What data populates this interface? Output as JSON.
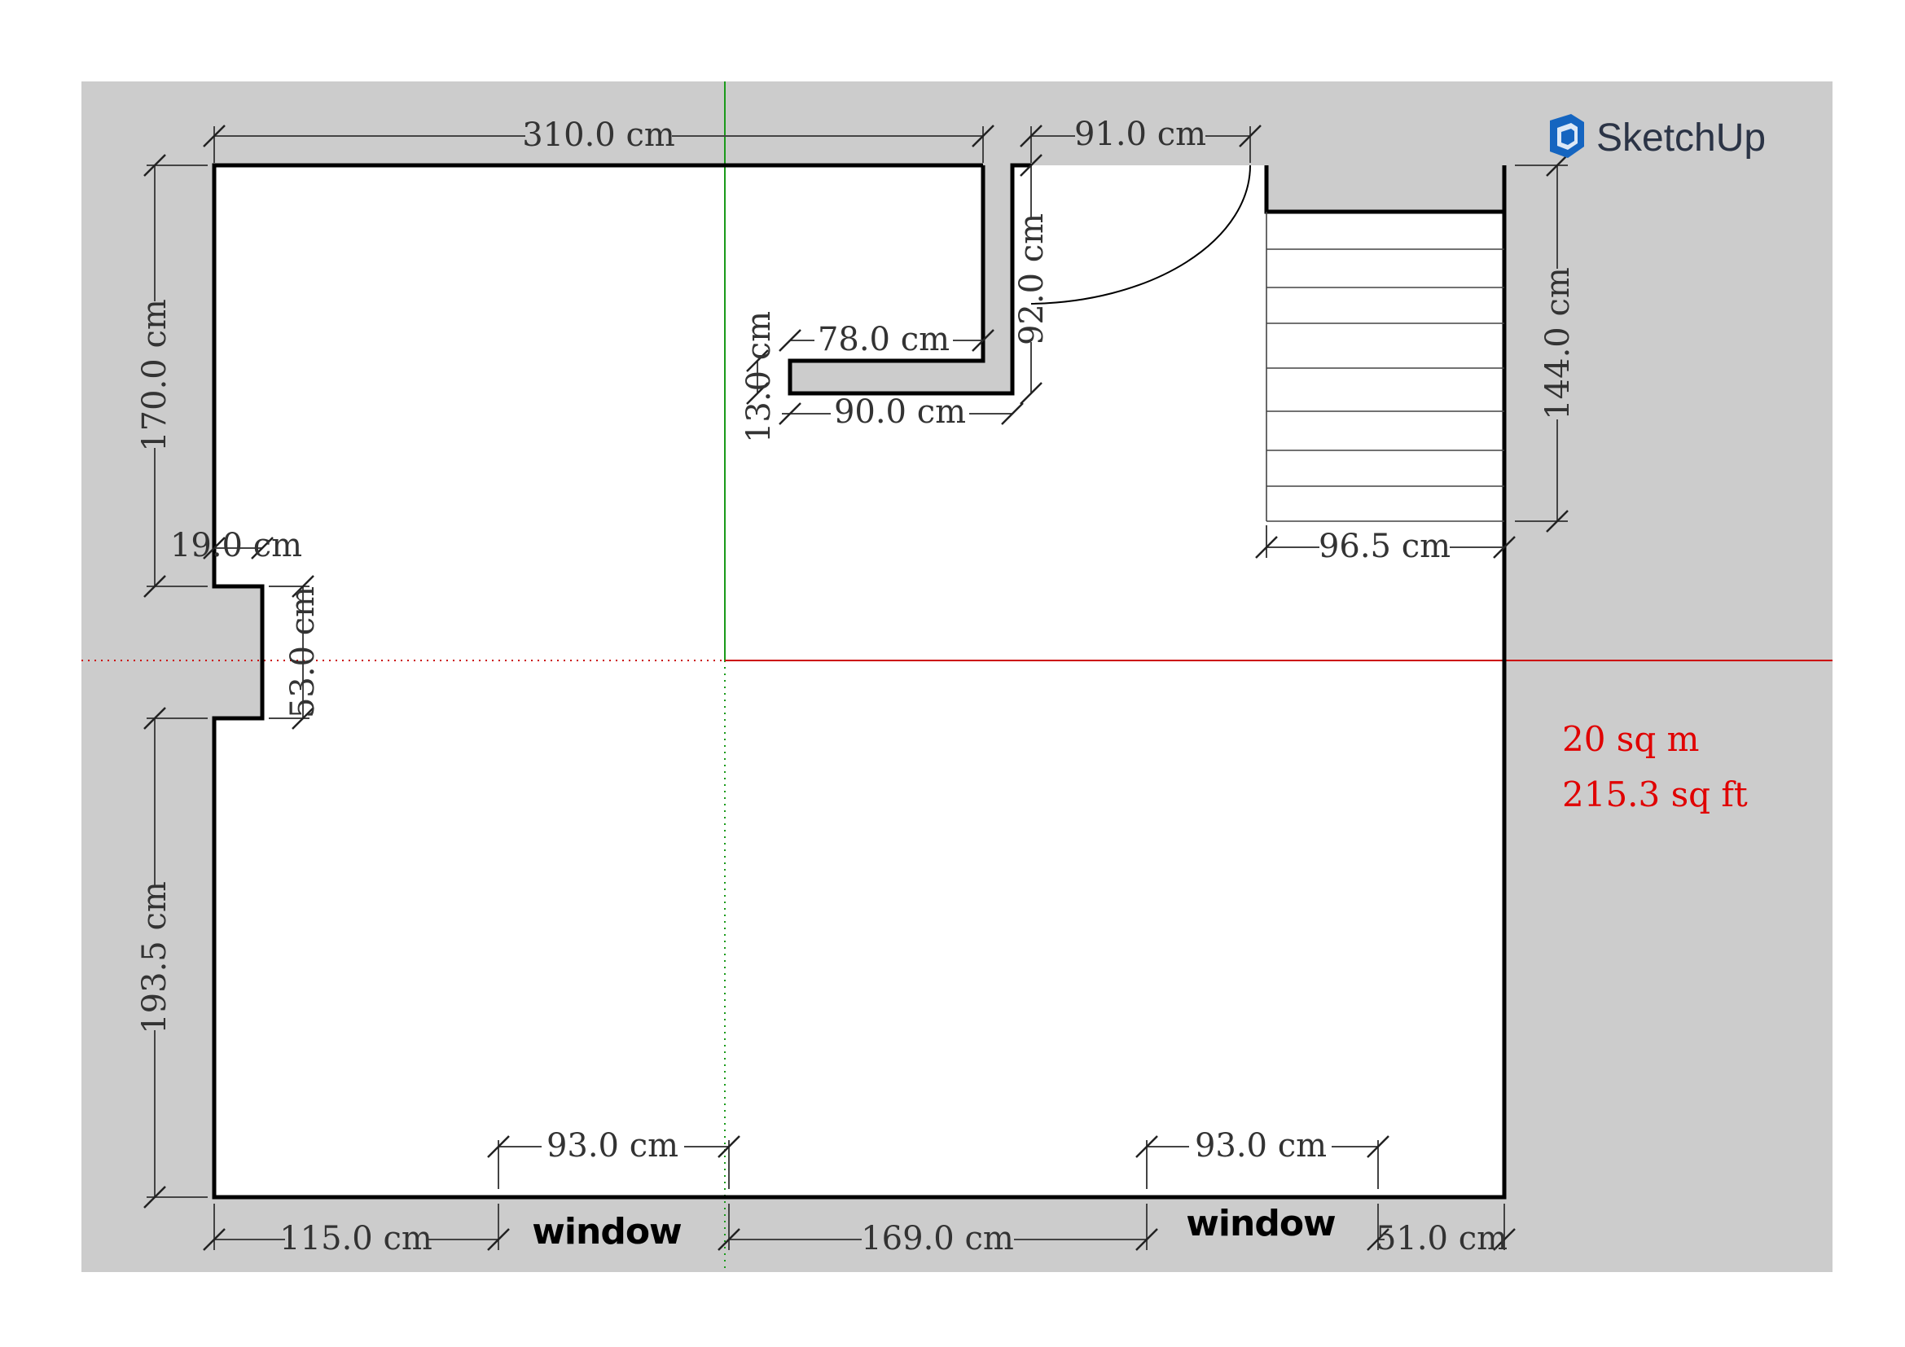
{
  "brand": {
    "name": "SketchUp",
    "logo_icon": "sketchup-logo-icon"
  },
  "colors": {
    "background": "#cccccc",
    "floor": "#ffffff",
    "wall": "#000000",
    "axis_green": "#1a9a1a",
    "axis_red": "#cc0000",
    "area_text": "#e00000"
  },
  "dimensions": {
    "top_left_width": "310.0 cm",
    "top_door_width": "91.0 cm",
    "left_upper_height": "170.0 cm",
    "left_recess_depth": "19.0 cm",
    "left_recess_height": "53.0 cm",
    "left_lower_height": "193.5 cm",
    "inner_wall_top": "78.0 cm",
    "inner_wall_bottom": "90.0 cm",
    "inner_wall_thickness": "13.0 cm",
    "door_wall_length": "92.0 cm",
    "stair_height": "144.0 cm",
    "stair_width": "96.5 cm",
    "window_left_width": "93.0 cm",
    "window_right_width": "93.0 cm",
    "bottom_seg_1": "115.0 cm",
    "bottom_seg_2": "169.0 cm",
    "bottom_seg_3": "51.0 cm"
  },
  "labels": {
    "window_left": "window",
    "window_right": "window"
  },
  "area": {
    "metric": "20 sq m",
    "imperial": "215.3 sq ft"
  }
}
